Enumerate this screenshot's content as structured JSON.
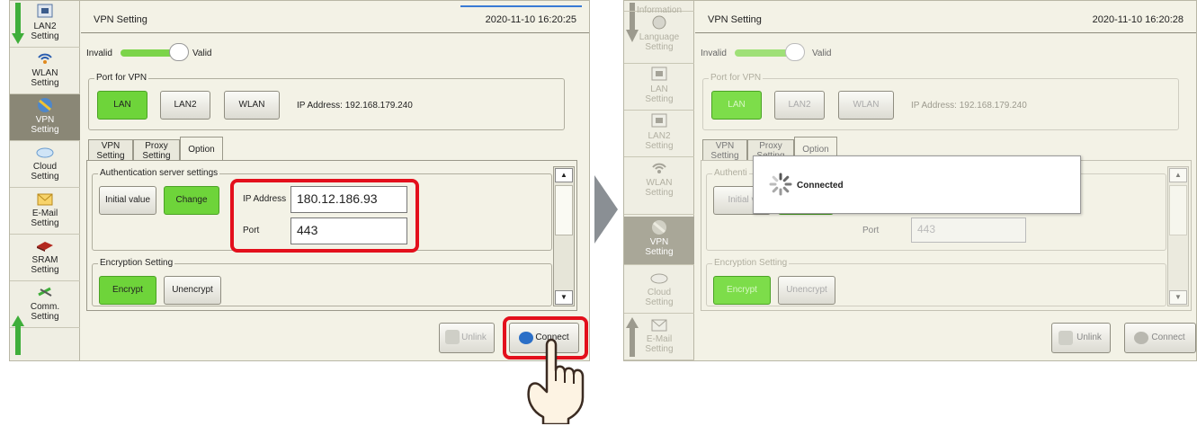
{
  "left": {
    "sidebar": [
      {
        "label": "LAN2\nSetting",
        "icon": "lan-icon"
      },
      {
        "label": "WLAN\nSetting",
        "icon": "wlan-icon"
      },
      {
        "label": "VPN\nSetting",
        "icon": "vpn-icon",
        "active": true
      },
      {
        "label": "Cloud\nSetting",
        "icon": "cloud-icon"
      },
      {
        "label": "E-Mail\nSetting",
        "icon": "mail-icon"
      },
      {
        "label": "SRAM\nSetting",
        "icon": "sram-icon"
      },
      {
        "label": "Comm.\nSetting",
        "icon": "comm-icon"
      }
    ],
    "title": "VPN Setting",
    "clock": "2020-11-10 16:20:25",
    "toggle": {
      "off_label": "Invalid",
      "on_label": "Valid",
      "state": "Valid"
    },
    "port_group": "Port for VPN",
    "port_buttons": [
      "LAN",
      "LAN2",
      "WLAN"
    ],
    "ip_display": "IP Address: 192.168.179.240",
    "tabs": [
      "VPN\nSetting",
      "Proxy\nSetting",
      "Option"
    ],
    "auth_group": "Authentication server settings",
    "initial_btn": "Initial value",
    "change_btn": "Change",
    "ip_label": "IP Address",
    "ip_value": "180.12.186.93",
    "port_label": "Port",
    "port_value": "443",
    "enc_group": "Encryption Setting",
    "encrypt_btn": "Encrypt",
    "unencrypt_btn": "Unencrypt",
    "unlink_btn": "Unlink",
    "connect_btn": "Connect"
  },
  "right": {
    "sidebar": [
      {
        "label": "Information",
        "icon": "info-icon"
      },
      {
        "label": "Language\nSetting",
        "icon": "language-icon"
      },
      {
        "label": "LAN\nSetting",
        "icon": "lan-icon"
      },
      {
        "label": "LAN2\nSetting",
        "icon": "lan-icon"
      },
      {
        "label": "WLAN\nSetting",
        "icon": "wlan-icon"
      },
      {
        "label": "VPN\nSetting",
        "icon": "vpn-icon",
        "active": true
      },
      {
        "label": "Cloud\nSetting",
        "icon": "cloud-icon"
      },
      {
        "label": "E-Mail\nSetting",
        "icon": "mail-icon"
      }
    ],
    "title": "VPN Setting",
    "clock": "2020-11-10 16:20:28",
    "toggle": {
      "off_label": "Invalid",
      "on_label": "Valid"
    },
    "port_group": "Port for VPN",
    "port_buttons": [
      "LAN",
      "LAN2",
      "WLAN"
    ],
    "ip_display": "IP Address: 192.168.179.240",
    "tabs": [
      "VPN\nSetting",
      "Proxy\nSetting",
      "Option"
    ],
    "auth_group_partial": "Authenti",
    "initial_partial": "Initial v",
    "port_label": "Port",
    "port_value": "443",
    "enc_group": "Encryption Setting",
    "encrypt_btn": "Encrypt",
    "unencrypt_btn": "Unencrypt",
    "unlink_btn": "Unlink",
    "connect_btn": "Connect",
    "dialog_text": "Connected"
  },
  "colors": {
    "accent_green": "#6ed43a",
    "highlight_red": "#e3101c",
    "panel_bg": "#f3f2e6"
  }
}
